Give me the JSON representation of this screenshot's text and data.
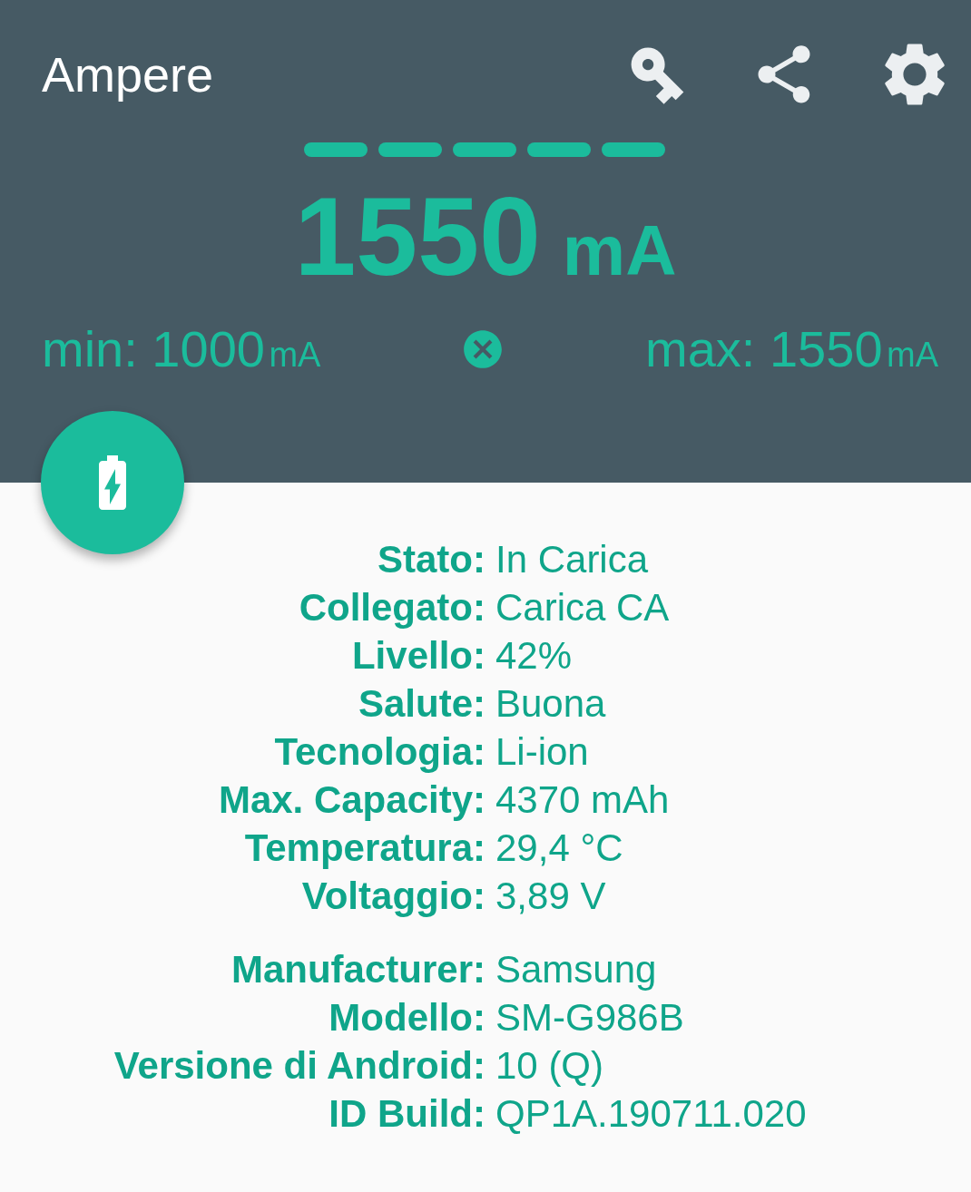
{
  "app_bar": {
    "title": "Ampere"
  },
  "meter": {
    "value": "1550",
    "unit": "mA"
  },
  "min": {
    "label": "min: 1000",
    "unit": "mA"
  },
  "max": {
    "label": "max: 1550",
    "unit": "mA"
  },
  "battery_info": [
    {
      "label": "Stato:",
      "value": "In Carica"
    },
    {
      "label": "Collegato:",
      "value": "Carica CA"
    },
    {
      "label": "Livello:",
      "value": "42%"
    },
    {
      "label": "Salute:",
      "value": "Buona"
    },
    {
      "label": "Tecnologia:",
      "value": "Li-ion"
    },
    {
      "label": "Max. Capacity:",
      "value": "4370 mAh"
    },
    {
      "label": "Temperatura:",
      "value": "29,4 °C"
    },
    {
      "label": "Voltaggio:",
      "value": "3,89 V"
    }
  ],
  "device_info": [
    {
      "label": "Manufacturer:",
      "value": "Samsung"
    },
    {
      "label": "Modello:",
      "value": "SM-G986B"
    },
    {
      "label": "Versione di Android:",
      "value": "10 (Q)"
    },
    {
      "label": "ID Build:",
      "value": "QP1A.190711.020"
    }
  ]
}
